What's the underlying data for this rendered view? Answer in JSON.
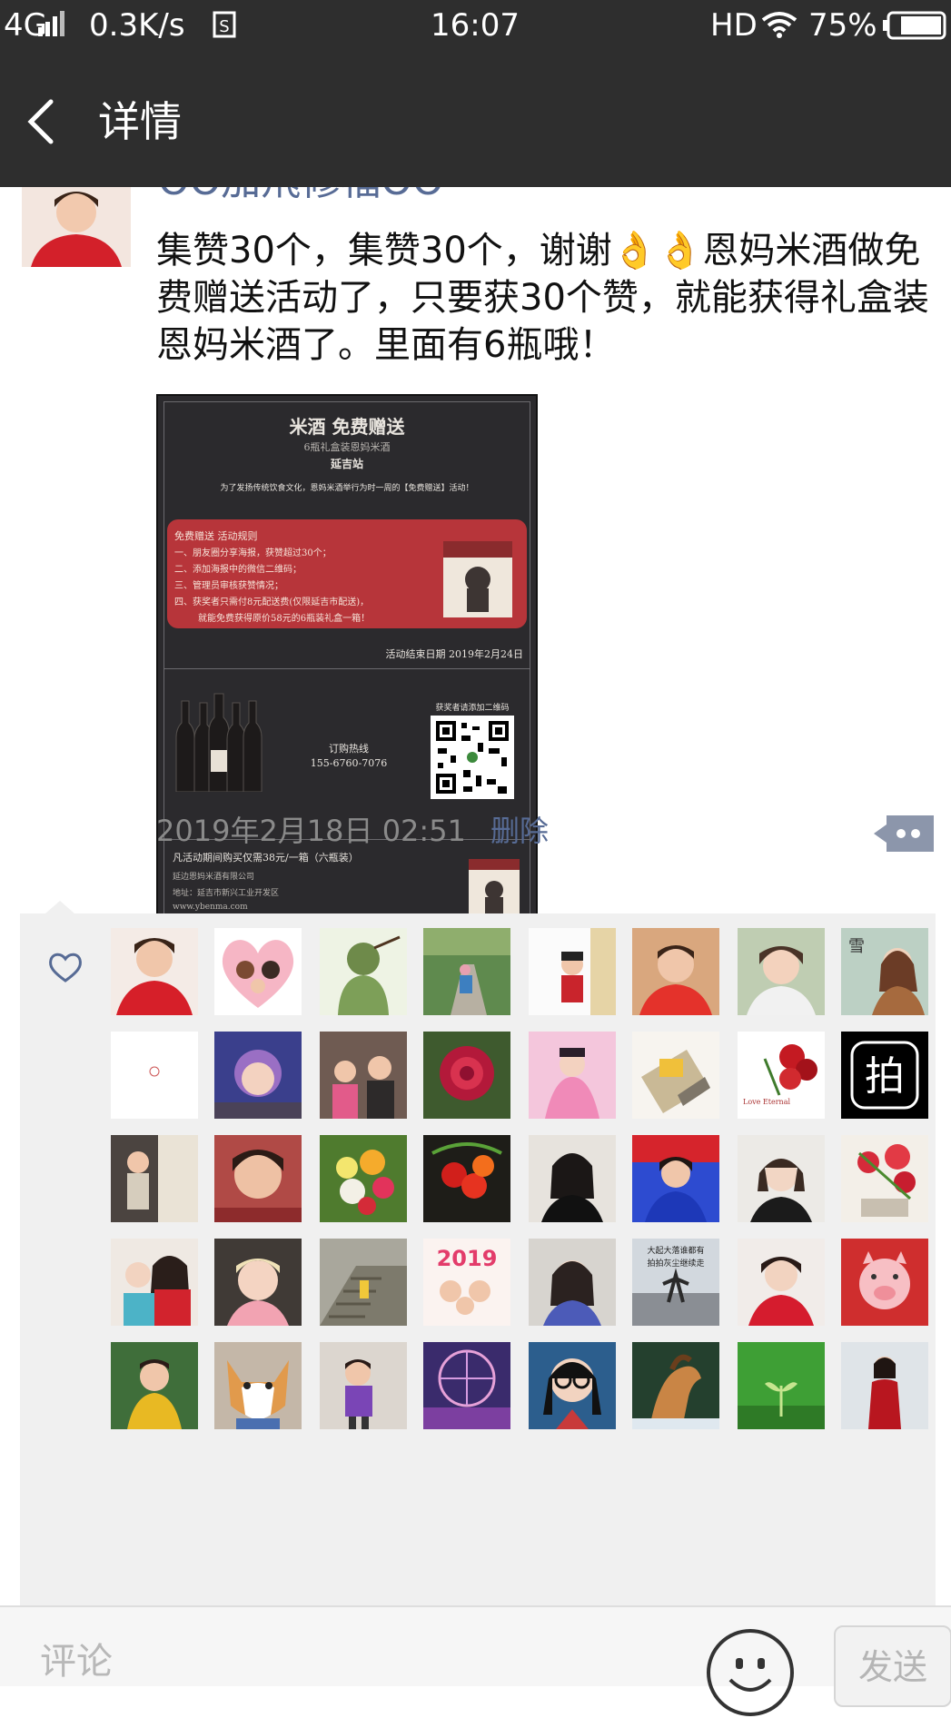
{
  "status_bar": {
    "network": "4G",
    "speed": "0.3K/s",
    "time": "16:07",
    "hd": "HD",
    "battery": "75%"
  },
  "nav": {
    "title": "详情"
  },
  "post": {
    "author_name": "OO加飛修福OO",
    "text": "集赞30个，集赞30个，谢谢👌👌恩妈米酒做免费赠送活动了，只要获30个赞，就能获得礼盒装恩妈米酒了。里面有6瓶哦！",
    "timestamp": "2019年2月18日 02:51",
    "delete_label": "删除"
  },
  "poster": {
    "title": "米酒 免费赠送",
    "subtitle": "6瓶礼盒装恩妈米酒",
    "city": "延吉站",
    "intro": "为了发扬传统饮食文化，恩妈米酒举行为时一周的【免费赠送】活动！",
    "rules_title": "免费赠送 活动规则",
    "rules": [
      "一、朋友圈分享海报，获赞超过30个；",
      "二、添加海报中的微信二维码；",
      "三、管理员审核获赞情况；",
      "四、获奖者只需付8元配送费(仅限延吉市配送)，",
      "就能免费获得原价58元的6瓶装礼盒一箱！"
    ],
    "end_date": "活动结束日期 2019年2月24日",
    "qr_caption": "获奖者请添加二维码",
    "hotline_label": "订购热线",
    "hotline": "155-6760-7076",
    "offer": "凡活动期间购买仅需38元/一箱（六瓶装）",
    "company": "延边恩妈米酒有限公司",
    "address": "地址：延吉市新兴工业开发区",
    "website": "www.ybenma.com"
  },
  "comment_bar": {
    "placeholder": "评论",
    "send_label": "发送"
  },
  "avatar_text": {
    "snow": "雪",
    "pai": "拍",
    "y2019": "2019",
    "love": "Love Eternal",
    "crowd": "大起大落谁都有",
    "crowd2": "拍拍灰尘继续走"
  },
  "colors": {
    "bar_bg": "#2e2e2e",
    "link": "#576b95",
    "panel_bg": "#f0f0f0"
  }
}
